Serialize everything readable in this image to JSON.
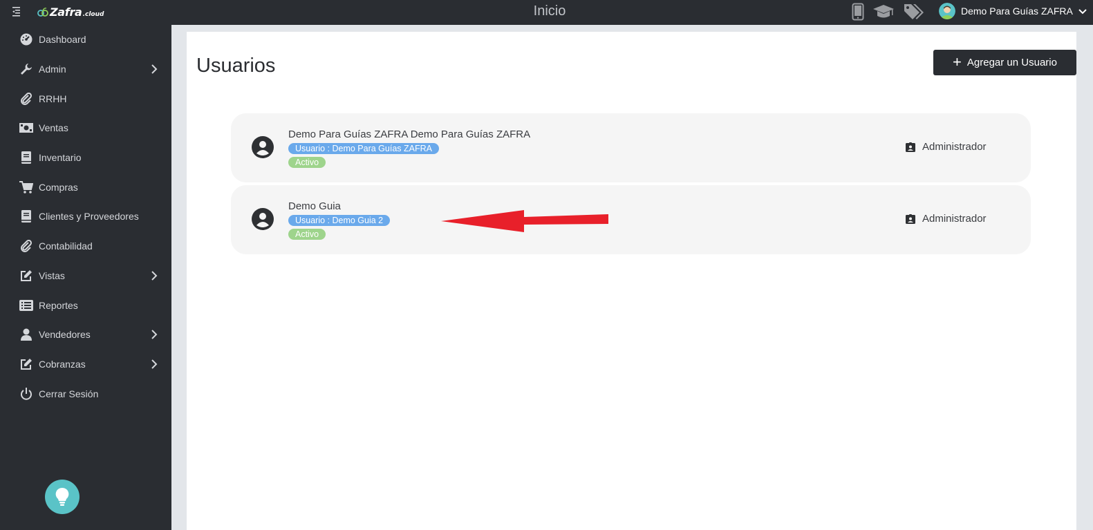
{
  "header": {
    "logo_name": "Zafra",
    "logo_tld": ".cloud",
    "title": "Inicio",
    "user_name": "Demo Para Guías ZAFRA",
    "icons": [
      "mobile-icon",
      "graduation-cap-icon",
      "tags-icon"
    ]
  },
  "sidebar": {
    "items": [
      {
        "label": "Dashboard",
        "icon": "dashboard-icon",
        "has_submenu": false
      },
      {
        "label": "Admin",
        "icon": "wrench-icon",
        "has_submenu": true
      },
      {
        "label": "RRHH",
        "icon": "paperclip-icon",
        "has_submenu": false
      },
      {
        "label": "Ventas",
        "icon": "money-icon",
        "has_submenu": false
      },
      {
        "label": "Inventario",
        "icon": "book-icon",
        "has_submenu": false
      },
      {
        "label": "Compras",
        "icon": "cart-icon",
        "has_submenu": false
      },
      {
        "label": "Clientes y Proveedores",
        "icon": "book-icon",
        "has_submenu": false
      },
      {
        "label": "Contabilidad",
        "icon": "paperclip-icon",
        "has_submenu": false
      },
      {
        "label": "Vistas",
        "icon": "edit-icon",
        "has_submenu": true
      },
      {
        "label": "Reportes",
        "icon": "list-icon",
        "has_submenu": false
      },
      {
        "label": "Vendedores",
        "icon": "user-icon",
        "has_submenu": true
      },
      {
        "label": "Cobranzas",
        "icon": "edit-icon",
        "has_submenu": true
      },
      {
        "label": "Cerrar Sesión",
        "icon": "power-icon",
        "has_submenu": false
      }
    ],
    "help_icon": "lightbulb-icon"
  },
  "main": {
    "title": "Usuarios",
    "add_button_label": "Agregar un Usuario",
    "users": [
      {
        "name": "Demo Para Guías ZAFRA Demo Para Guías ZAFRA",
        "username_badge": "Usuario : Demo Para Guías ZAFRA",
        "status": "Activo",
        "role": "Administrador"
      },
      {
        "name": "Demo Guia",
        "username_badge": "Usuario : Demo Guia 2",
        "status": "Activo",
        "role": "Administrador"
      }
    ]
  },
  "colors": {
    "sidebar_bg": "#2a2d32",
    "user_badge": "#6aa9eb",
    "status_badge": "#9ed48c",
    "help_fab": "#5ac3c7",
    "annotation_arrow": "#e8202a"
  }
}
